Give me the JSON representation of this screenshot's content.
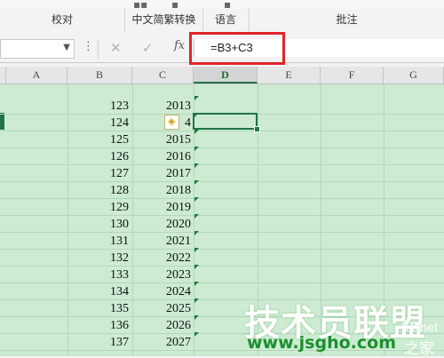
{
  "ribbon": {
    "groups": [
      "校对",
      "中文简繁转换",
      "语言",
      "批注"
    ]
  },
  "formula_bar": {
    "formula": "=B3+C3",
    "cancel_symbol": "✕",
    "enter_symbol": "✓",
    "function_symbol": "fx"
  },
  "columns": [
    "A",
    "B",
    "C",
    "D",
    "E",
    "F",
    "G"
  ],
  "active_column": "D",
  "cells": {
    "B": [
      "123",
      "124",
      "125",
      "126",
      "127",
      "128",
      "129",
      "130",
      "131",
      "132",
      "133",
      "134",
      "135",
      "136",
      "137"
    ],
    "C": [
      "2013",
      "4",
      "2015",
      "2016",
      "2017",
      "2018",
      "2019",
      "2020",
      "2021",
      "2022",
      "2023",
      "2024",
      "2025",
      "2026",
      "2027"
    ]
  },
  "watermark": {
    "main": "技术员联盟",
    "url": "www.jsgho.com",
    "side_top": "51.net",
    "side_bottom": "之家"
  },
  "colors": {
    "sheet_background": "#ccebd2",
    "highlight_box": "#e0242b",
    "selection": "#217346"
  }
}
